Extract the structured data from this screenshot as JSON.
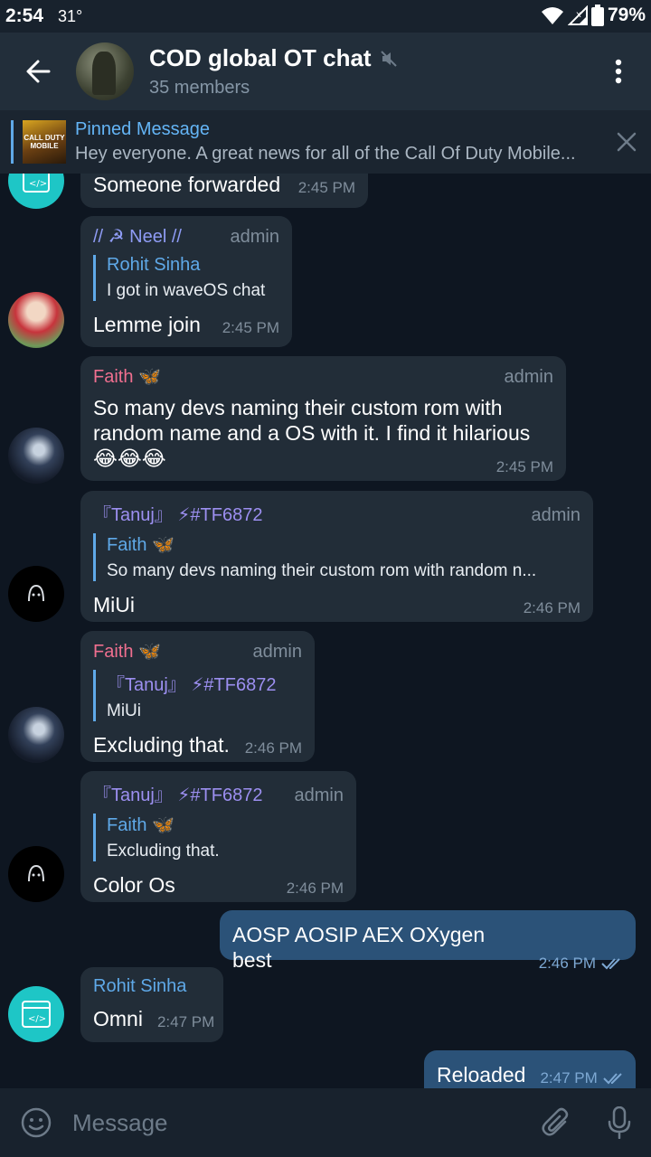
{
  "status_bar": {
    "time": "2:54",
    "temperature": "31°",
    "battery": "79%"
  },
  "header": {
    "title": "COD global OT chat",
    "subtitle": "35 members"
  },
  "pinned": {
    "title": "Pinned Message",
    "text": "Hey everyone.  A great news for all of the Call Of Duty Mobile...",
    "thumb_text": "CALL DUTY MOBILE"
  },
  "messages": [
    {
      "text": "Someone forwarded",
      "time": "2:45 PM"
    },
    {
      "sender": "// ☭ Neel //",
      "role": "admin",
      "reply_name": "Rohit Sinha",
      "reply_text": "I got in waveOS chat",
      "text": "Lemme join",
      "time": "2:45 PM"
    },
    {
      "sender": "Faith 🦋",
      "role": "admin",
      "text": "So many devs naming their custom rom with random name and a OS with it. I find it hilarious 😂😂😂",
      "time": "2:45 PM"
    },
    {
      "sender": "『Tanuj』 ⚡#TF6872",
      "role": "admin",
      "reply_name": "Faith 🦋",
      "reply_text": "So many devs naming their custom rom with random n...",
      "text": "MiUi",
      "time": "2:46 PM"
    },
    {
      "sender": "Faith 🦋",
      "role": "admin",
      "reply_name": "『Tanuj』 ⚡#TF6872",
      "reply_text": "MiUi",
      "text": "Excluding that.",
      "time": "2:46 PM"
    },
    {
      "sender": "『Tanuj』 ⚡#TF6872",
      "role": "admin",
      "reply_name": "Faith 🦋",
      "reply_text": "Excluding that.",
      "text": "Color Os",
      "time": "2:46 PM"
    },
    {
      "text": "AOSP AOSIP AEX OXygen best",
      "time": "2:46 PM",
      "outgoing": true
    },
    {
      "sender": "Rohit Sinha",
      "text": "Omni",
      "time": "2:47 PM"
    },
    {
      "text": "Reloaded",
      "time": "2:47 PM",
      "outgoing": true
    }
  ],
  "input": {
    "placeholder": "Message"
  },
  "colors": {
    "background": "#0e1621",
    "header": "#222e3a",
    "bubble_in": "#222d38",
    "bubble_out": "#2b5278",
    "accent": "#5fa9e8"
  },
  "icons": [
    "back-arrow-icon",
    "mute-icon",
    "more-vert-icon",
    "close-icon",
    "code-icon",
    "emoji-icon",
    "attach-icon",
    "mic-icon",
    "double-check-icon",
    "wifi-icon",
    "signal-icon",
    "battery-icon"
  ]
}
